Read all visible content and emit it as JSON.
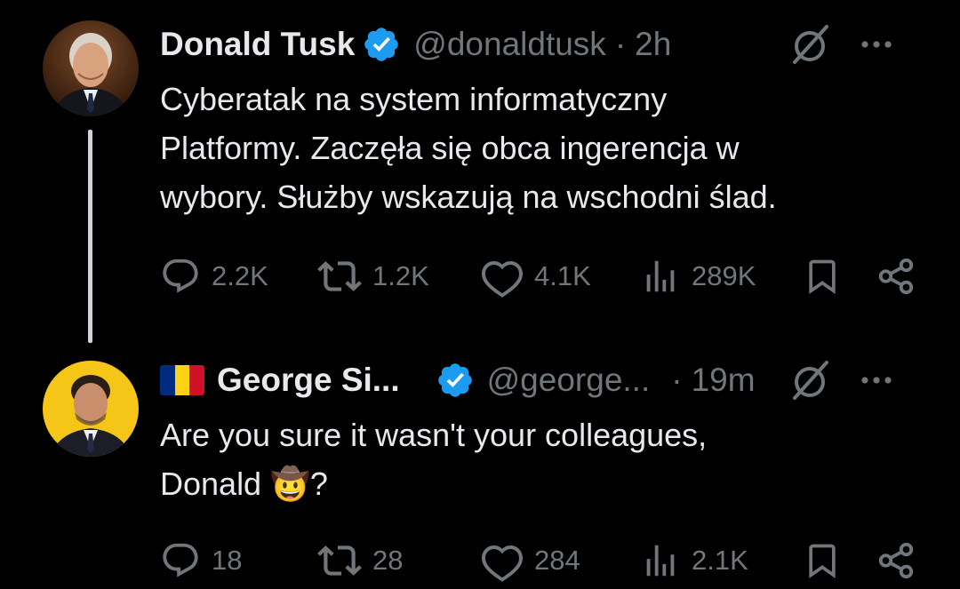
{
  "tweets": [
    {
      "author": {
        "display_name": "Donald Tusk",
        "handle": "@donaldtusk",
        "verified": true,
        "avatar": "avatar-portrait"
      },
      "separator": "·",
      "time": "2h",
      "text": "Cyberatak na system informatyczny\nPlatformy. Zaczęła się obca ingerencja w\nwybory. Służby wskazują na wschodni ślad.",
      "stats": {
        "replies": "2.2K",
        "retweets": "1.2K",
        "likes": "4.1K",
        "views": "289K"
      }
    },
    {
      "author": {
        "display_name": "George Si...",
        "handle": "@george...",
        "verified": true,
        "flag": "romania-flag-emoji",
        "avatar": "avatar-portrait"
      },
      "separator": "·",
      "time": "19m",
      "text": "Are you sure it wasn't your colleagues,\nDonald 🤠?",
      "stats": {
        "replies": "18",
        "retweets": "28",
        "likes": "284",
        "views": "2.1K"
      }
    }
  ],
  "icons": {
    "reply": "reply-icon",
    "retweet": "retweet-icon",
    "like": "heart-icon",
    "views": "views-icon",
    "bookmark": "bookmark-icon",
    "share": "share-icon",
    "grok": "grok-icon",
    "more": "more-icon",
    "verified": "verified-badge-icon"
  },
  "colors": {
    "background": "#000000",
    "text_primary": "#e7e9ea",
    "text_secondary": "#71767b",
    "verified_blue": "#1d9bf0",
    "thread_line": "#d0d4d8",
    "avatar2_background": "#f5c518"
  }
}
